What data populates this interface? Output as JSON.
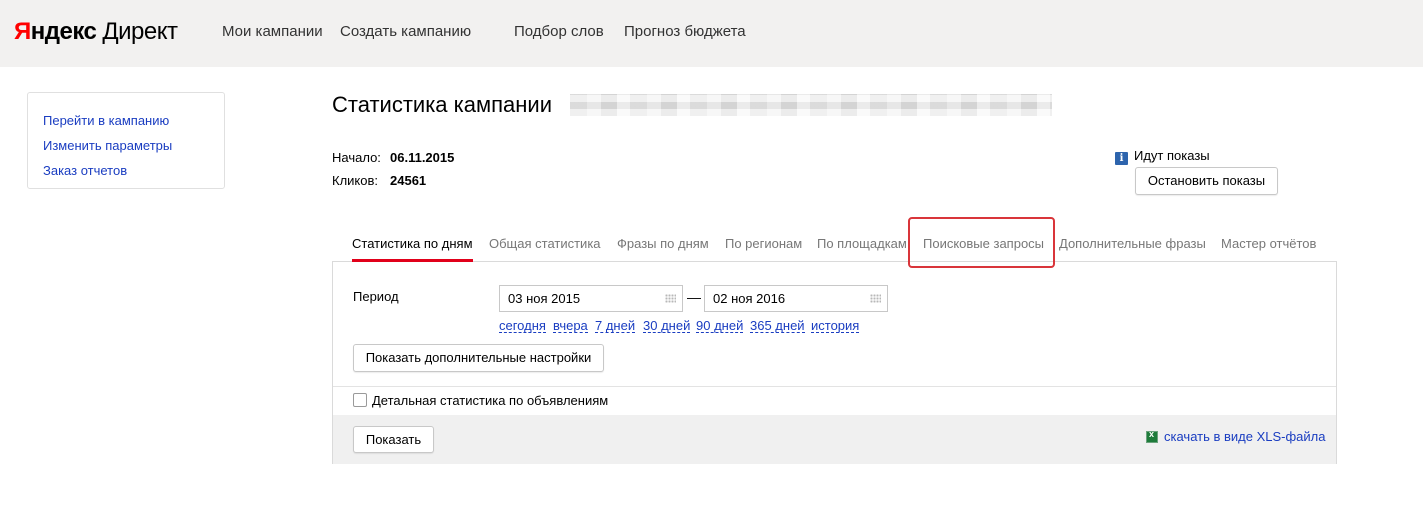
{
  "header": {
    "logo_ya_first": "Я",
    "logo_ya_rest": "ндекс",
    "logo_direkt": "Директ",
    "nav": [
      "Мои кампании",
      "Создать кампанию",
      "Подбор слов",
      "Прогноз бюджета"
    ]
  },
  "sidebar": {
    "links": [
      "Перейти в кампанию",
      "Изменить параметры",
      "Заказ отчетов"
    ]
  },
  "page": {
    "title": "Статистика кампании"
  },
  "info": {
    "start_label": "Начало:",
    "start_value": "06.11.2015",
    "clicks_label": "Кликов:",
    "clicks_value": "24561"
  },
  "status": {
    "icon": "i",
    "text": "Идут показы",
    "stop_button": "Остановить показы"
  },
  "tabs": [
    "Статистика по дням",
    "Общая статистика",
    "Фразы по дням",
    "По регионам",
    "По площадкам",
    "Поисковые запросы",
    "Дополнительные фразы",
    "Мастер отчётов"
  ],
  "filter": {
    "period_label": "Период",
    "date_from": "03 ноя 2015",
    "date_to": "02 ноя 2016",
    "dash": "—",
    "quick_ranges": [
      "сегодня",
      "вчера",
      "7 дней",
      "30 дней",
      "90 дней",
      "365 дней",
      "история"
    ],
    "more_settings_button": "Показать дополнительные настройки",
    "detail_checkbox_label": "Детальная статистика по объявлениям",
    "detail_checkbox_checked": false,
    "show_button": "Показать",
    "xls_link": "скачать в виде XLS-файла"
  },
  "colors": {
    "link": "#1a3dc1",
    "active_tab_underline": "#e1001a",
    "highlight_border": "#d9353a",
    "header_bg": "#f2f1f0"
  }
}
